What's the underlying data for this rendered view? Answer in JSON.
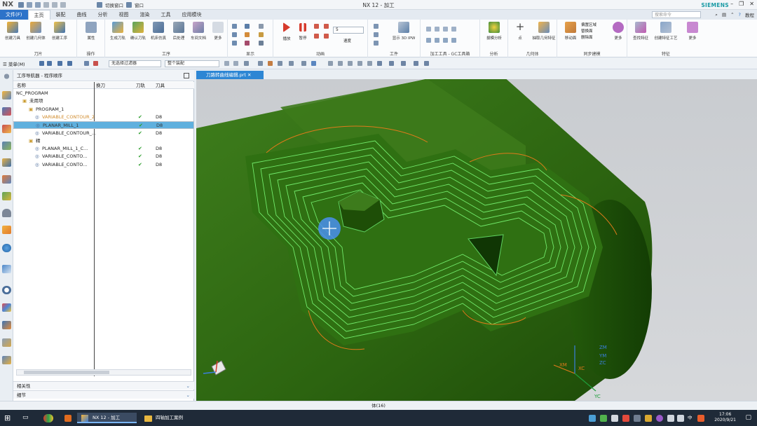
{
  "app": {
    "logo": "NX",
    "title": "NX 12 - 加工",
    "brand": "SIEMENS",
    "quick_access": [
      "切换窗口",
      "窗口"
    ]
  },
  "tabs": [
    "文件(F)",
    "主页",
    "装配",
    "曲线",
    "分析",
    "视图",
    "渲染",
    "工具",
    "应用模块"
  ],
  "active_tab": "主页",
  "search_placeholder": "搜索命令",
  "teaching_label": "教程",
  "ribbon": {
    "groups": [
      {
        "label": "刀片",
        "buttons": [
          "创建刀具",
          "创建几何体",
          "创建工序"
        ]
      },
      {
        "label": "操作",
        "buttons": [
          "属性"
        ]
      },
      {
        "label": "工序",
        "buttons": [
          "生成刀轨",
          "确认刀轨",
          "机床仿真",
          "后处理",
          "车间文档",
          "更多"
        ]
      },
      {
        "label": "显示",
        "buttons": []
      },
      {
        "label": "动画",
        "buttons": [
          "播放",
          "暂停",
          "速度"
        ]
      },
      {
        "label": "工件",
        "buttons": [
          "显示 3D IPW"
        ]
      },
      {
        "label": "加工工具 - GC工具箱",
        "buttons": []
      },
      {
        "label": "分析",
        "buttons": [
          "拔模分析"
        ]
      },
      {
        "label": "几何体",
        "buttons": [
          "点",
          "抽取几何特征"
        ]
      },
      {
        "label": "同步建模",
        "buttons": [
          "移动面",
          "偏置区域",
          "替换面",
          "删除面",
          "更多"
        ]
      },
      {
        "label": "特征",
        "buttons": [
          "查找特征",
          "创建特征工艺",
          "更多"
        ]
      }
    ],
    "speed_value": "5"
  },
  "selection_bar": {
    "menu_label": "菜单(M)",
    "filter": "无选择过滤器",
    "scope": "整个装配"
  },
  "navigator": {
    "title": "工序导航器 - 程序顺序",
    "columns": [
      "名称",
      "换刀",
      "刀轨",
      "刀具"
    ],
    "rows": [
      {
        "name": "NC_PROGRAM",
        "indent": 0,
        "path": "",
        "tool": ""
      },
      {
        "name": "未用项",
        "indent": 1,
        "path": "",
        "tool": ""
      },
      {
        "name": "PROGRAM_1",
        "indent": 2,
        "path": "",
        "tool": ""
      },
      {
        "name": "VARIABLE_CONTOUR_2",
        "indent": 3,
        "path": "✔",
        "tool": "D8"
      },
      {
        "name": "PLANAR_MILL_1",
        "indent": 3,
        "path": "✔",
        "tool": "D8",
        "selected": true
      },
      {
        "name": "VARIABLE_CONTOUR_...",
        "indent": 3,
        "path": "✔",
        "tool": "D8"
      },
      {
        "name": "精",
        "indent": 2,
        "path": "",
        "tool": ""
      },
      {
        "name": "PLANAR_MILL_1_C...",
        "indent": 3,
        "path": "✔",
        "tool": "D8"
      },
      {
        "name": "VARIABLE_CONTO...",
        "indent": 3,
        "path": "✔",
        "tool": "D8"
      },
      {
        "name": "VARIABLE_CONTO...",
        "indent": 3,
        "path": "✔",
        "tool": "D8"
      }
    ],
    "related_label": "相关性",
    "detail_label": "细节"
  },
  "viewport": {
    "tab_label": "刀路转曲线编辑.prt",
    "axis_labels": [
      "ZM",
      "YM",
      "XM",
      "XC",
      "YC",
      "ZC"
    ]
  },
  "status_text": "体(16)",
  "taskbar": {
    "items": [
      "NX 12 - 加工",
      "四轴加工案例"
    ],
    "time": "17:06",
    "date": "2020/9/21",
    "ime": "中"
  },
  "colors": {
    "accent": "#2d73c9",
    "model": "#2f6b12",
    "toolpath": "#7dff7a",
    "selected_row": "#5fb0de"
  }
}
